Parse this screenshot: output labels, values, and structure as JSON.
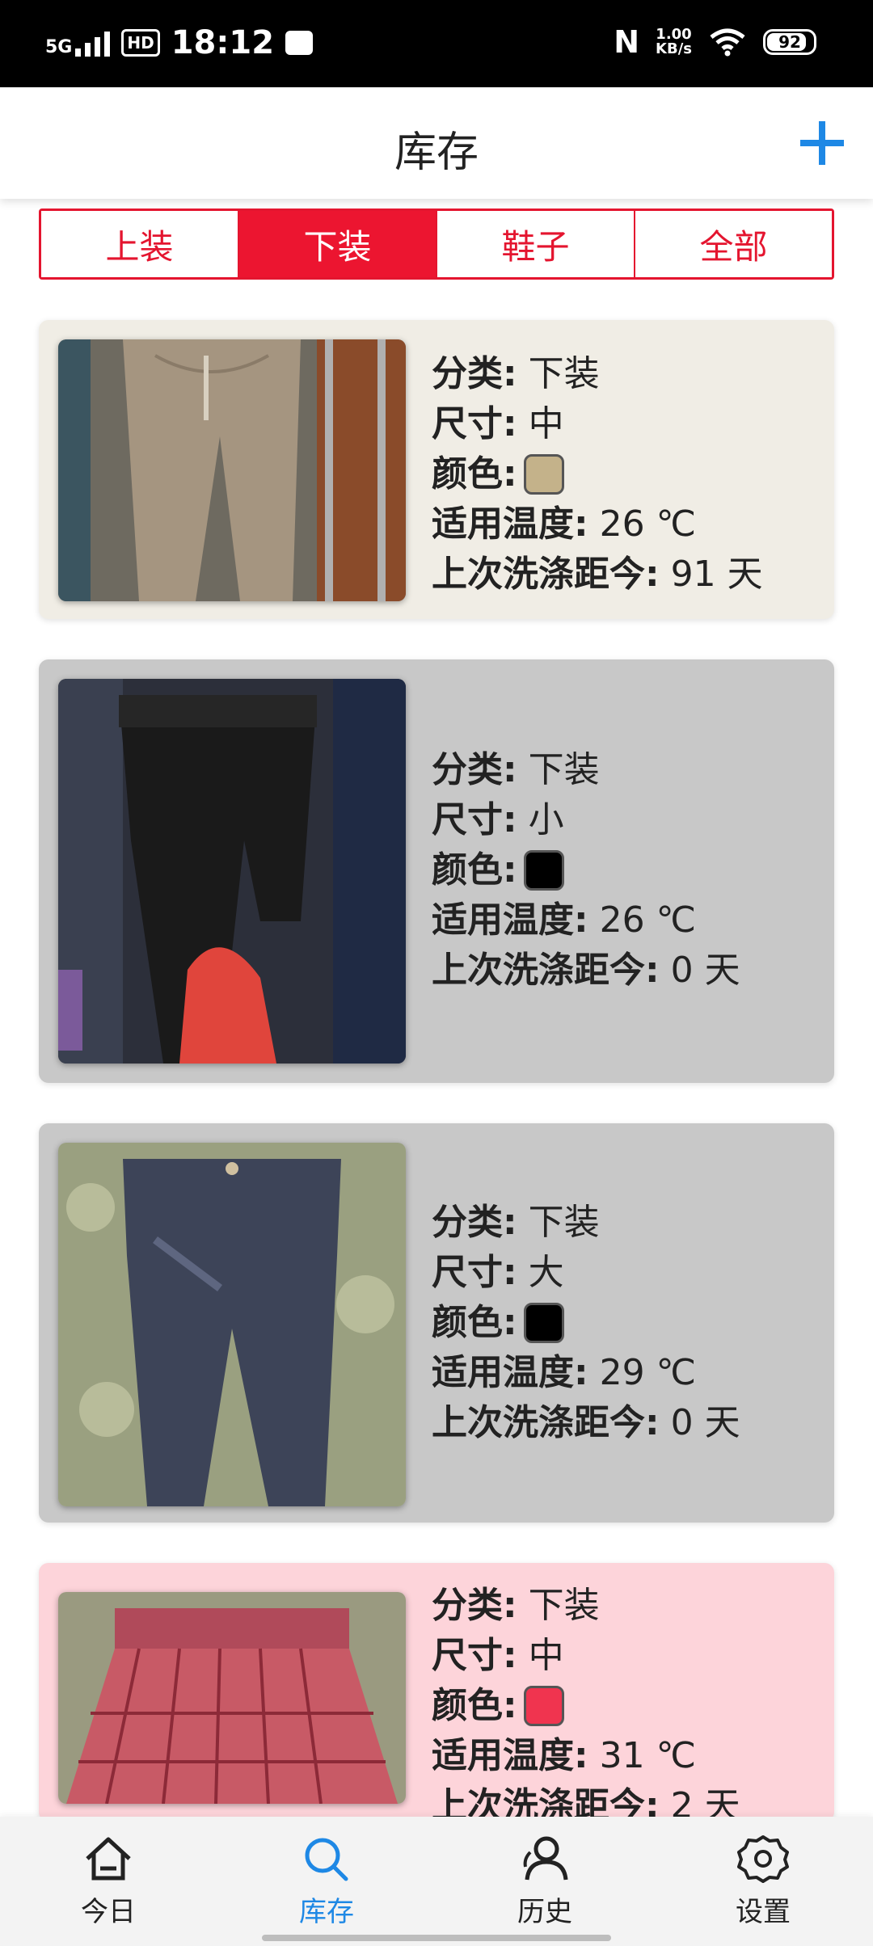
{
  "status_bar": {
    "network": "5G",
    "hd": "HD",
    "time": "18:12",
    "speed_value": "1.00",
    "speed_unit": "KB/s",
    "battery": "92"
  },
  "header": {
    "title": "库存",
    "add_icon": "plus-icon",
    "accent_color": "#1e88e5"
  },
  "tabs": [
    {
      "label": "上装",
      "active": false
    },
    {
      "label": "下装",
      "active": true
    },
    {
      "label": "鞋子",
      "active": false
    },
    {
      "label": "全部",
      "active": false
    }
  ],
  "labels": {
    "category": "分类:",
    "size": "尺寸:",
    "color": "颜色:",
    "temperature": "适用温度:",
    "last_wash": "上次洗涤距今:"
  },
  "items": [
    {
      "category": "下装",
      "size": "中",
      "color_hex": "#c4b28a",
      "temperature": "26 ℃",
      "last_wash": "91 天",
      "card_bg": "#f0ede5"
    },
    {
      "category": "下装",
      "size": "小",
      "color_hex": "#000000",
      "temperature": "26 ℃",
      "last_wash": "0 天",
      "card_bg": "#c8c8c8"
    },
    {
      "category": "下装",
      "size": "大",
      "color_hex": "#000000",
      "temperature": "29 ℃",
      "last_wash": "0 天",
      "card_bg": "#c8c8c8"
    },
    {
      "category": "下装",
      "size": "中",
      "color_hex": "#f0344f",
      "temperature": "31 ℃",
      "last_wash": "2 天",
      "card_bg": "#fdd4da"
    }
  ],
  "bottom_nav": [
    {
      "label": "今日",
      "icon": "home-icon",
      "active": false
    },
    {
      "label": "库存",
      "icon": "search-icon",
      "active": true
    },
    {
      "label": "历史",
      "icon": "people-icon",
      "active": false
    },
    {
      "label": "设置",
      "icon": "gear-icon",
      "active": false
    }
  ]
}
